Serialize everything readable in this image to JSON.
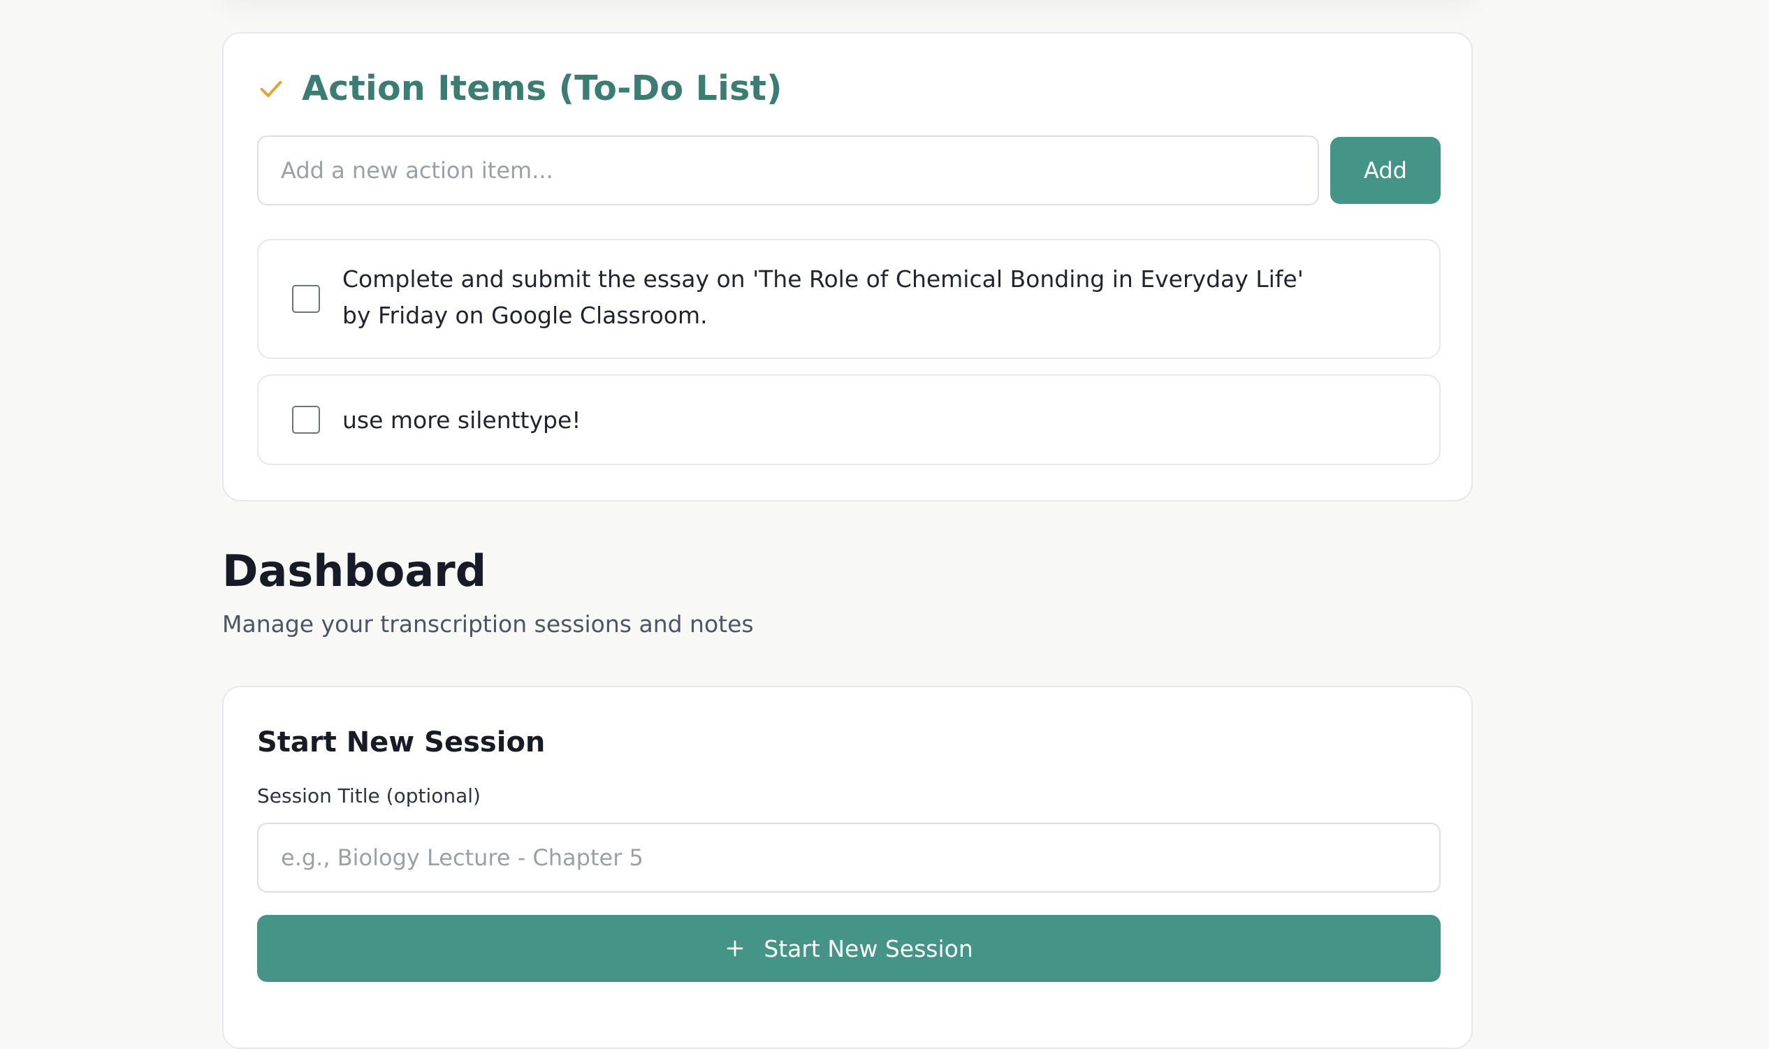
{
  "action_items": {
    "title": "Action Items (To-Do List)",
    "icon": "check-icon",
    "accent_color": "#e3a23a",
    "title_color": "#3b7d73",
    "input_placeholder": "Add a new action item...",
    "input_value": "",
    "add_label": "Add",
    "items": [
      {
        "text": "Complete and submit the essay on 'The Role of Chemical Bonding in Everyday Life' by Friday on Google Classroom.",
        "checked": false
      },
      {
        "text": "use more silenttype!",
        "checked": false
      }
    ]
  },
  "dashboard": {
    "title": "Dashboard",
    "subtitle": "Manage your transcription sessions and notes"
  },
  "new_session": {
    "title": "Start New Session",
    "field_label": "Session Title (optional)",
    "input_placeholder": "e.g., Biology Lecture - Chapter 5",
    "input_value": "",
    "button_label": "Start New Session",
    "button_icon": "plus-icon",
    "button_color": "#449588"
  }
}
